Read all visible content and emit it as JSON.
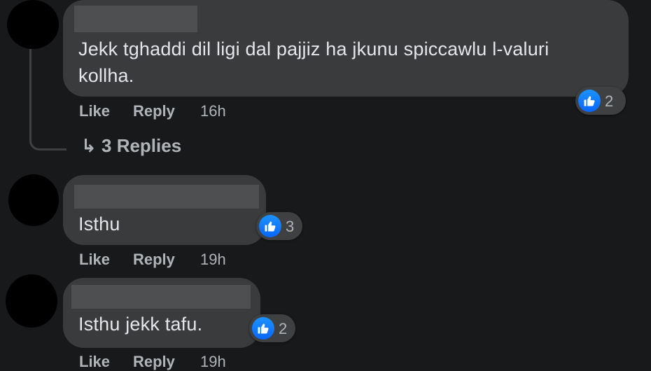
{
  "comments": [
    {
      "text_lines": [
        "Jekk tghaddi dil ligi dal pajjiz ha jkunu spiccawlu l-valuri",
        "kollha."
      ],
      "reaction_count": "2",
      "like_label": "Like",
      "reply_label": "Reply",
      "time": "16h"
    },
    {
      "text_lines": [
        "Isthu"
      ],
      "reaction_count": "3",
      "like_label": "Like",
      "reply_label": "Reply",
      "time": "19h"
    },
    {
      "text_lines": [
        "Isthu jekk tafu."
      ],
      "reaction_count": "2",
      "like_label": "Like",
      "reply_label": "Reply",
      "time": "19h"
    }
  ],
  "thread": {
    "replies_label": "↳ 3 Replies"
  },
  "colors": {
    "background": "#18191a",
    "bubble": "#3a3b3c",
    "text": "#e4e6eb",
    "secondary_text": "#b0b3b8",
    "like_blue": "#0866ff"
  },
  "icons": [
    "thumbs-up-icon",
    "reply-arrow-icon"
  ]
}
